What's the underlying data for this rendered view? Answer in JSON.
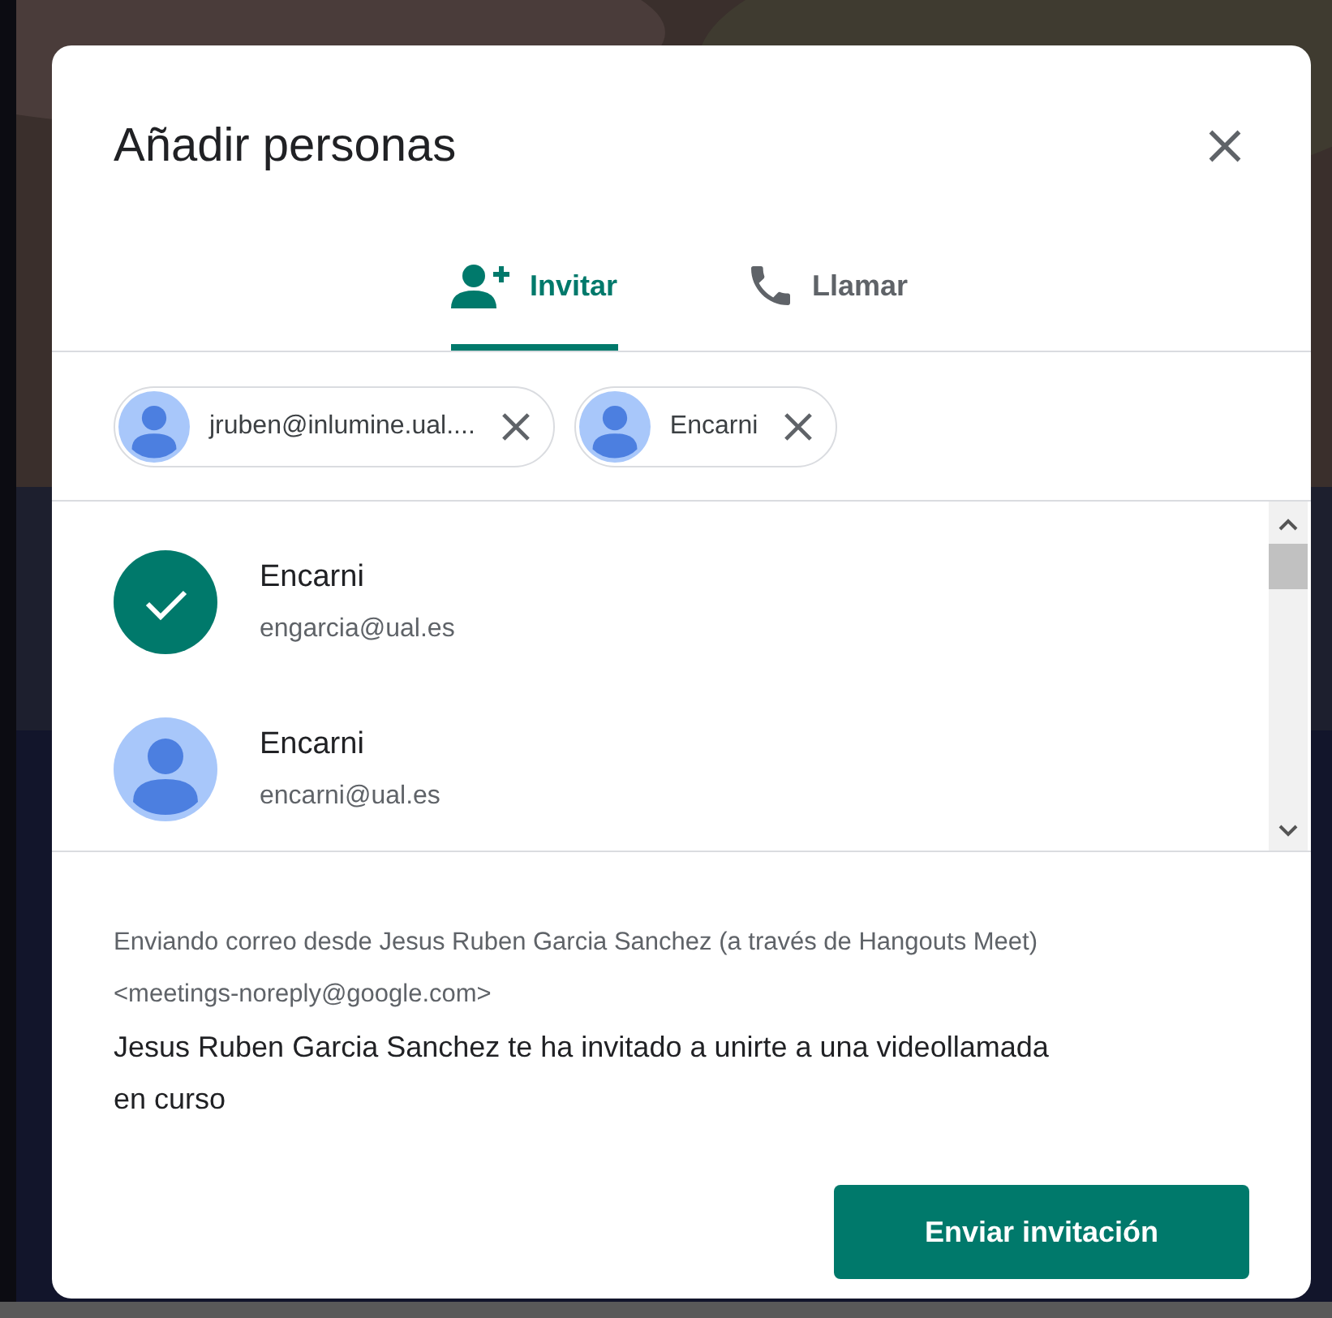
{
  "dialog": {
    "title": "Añadir personas"
  },
  "tabs": [
    {
      "label": "Invitar",
      "selected": true
    },
    {
      "label": "Llamar",
      "selected": false
    }
  ],
  "chips": [
    {
      "label": "jruben@inlumine.ual...."
    },
    {
      "label": "Encarni"
    }
  ],
  "results": [
    {
      "name": "Encarni",
      "email": "engarcia@ual.es",
      "selected": true
    },
    {
      "name": "Encarni",
      "email": "encarni@ual.es",
      "selected": false
    }
  ],
  "sender_note": "Enviando correo desde Jesus Ruben Garcia Sanchez (a través de Hangouts Meet) <meetings-noreply@google.com>",
  "message": "Jesus Ruben Garcia Sanchez te ha invitado a unirte a una videollamada en curso",
  "send_button": "Enviar invitación"
}
